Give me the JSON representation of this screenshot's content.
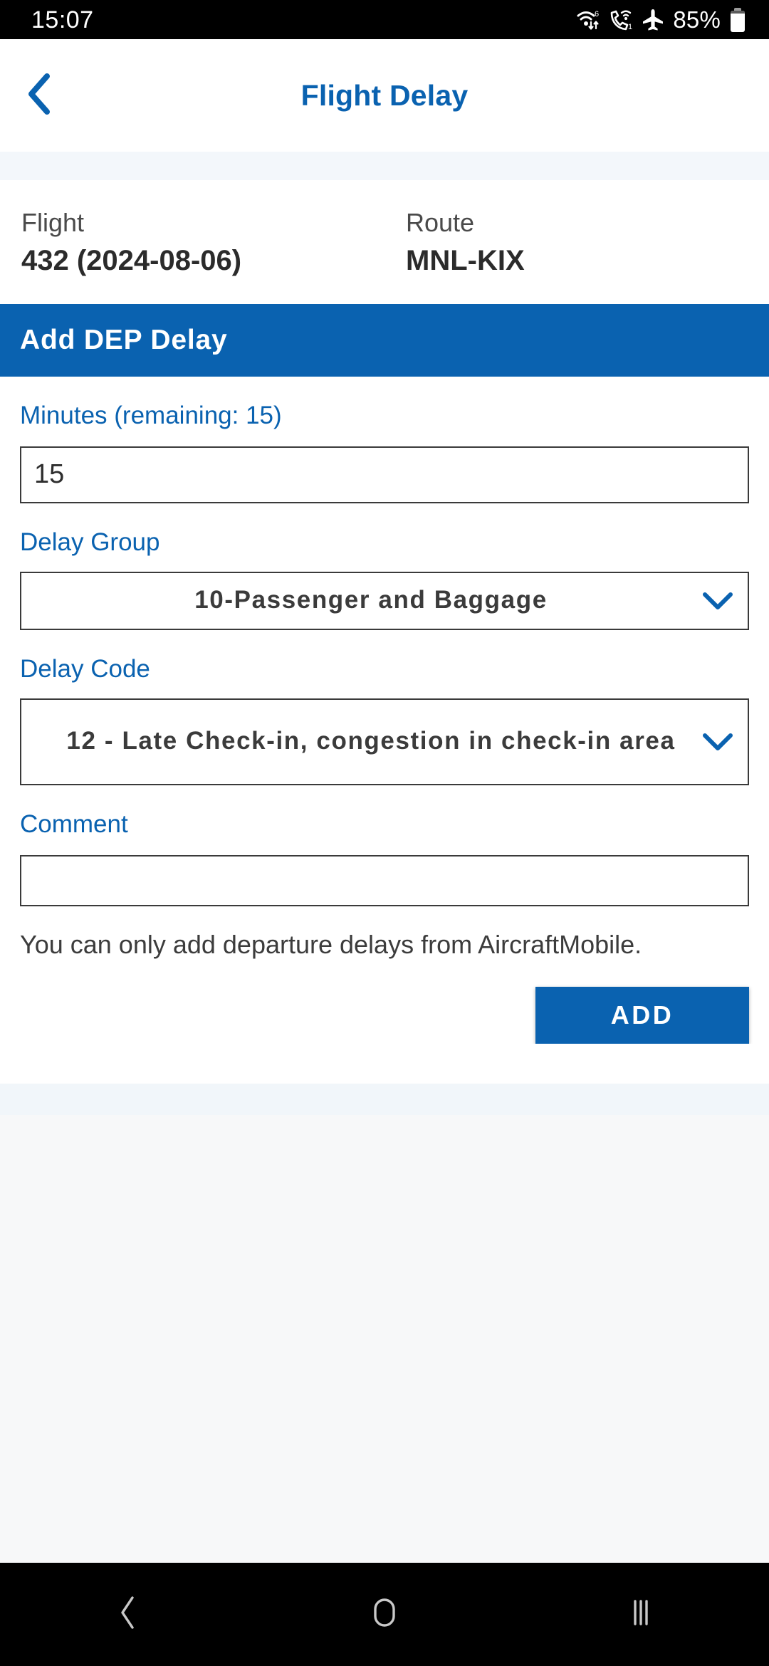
{
  "status_bar": {
    "time": "15:07",
    "battery_percent": "85%",
    "icons": [
      "wifi-6-icon",
      "wifi-calling-icon",
      "airplane-mode-icon",
      "battery-icon"
    ]
  },
  "header": {
    "title": "Flight Delay",
    "back_icon": "chevron-left-icon"
  },
  "flight_info": {
    "flight_label": "Flight",
    "flight_value": "432 (2024-08-06)",
    "route_label": "Route",
    "route_value": "MNL-KIX"
  },
  "section": {
    "title": "Add DEP Delay"
  },
  "form": {
    "minutes": {
      "label": "Minutes (remaining: 15)",
      "value": "15",
      "placeholder": ""
    },
    "delay_group": {
      "label": "Delay Group",
      "value": "10-Passenger and Baggage",
      "chevron_icon": "chevron-down-icon"
    },
    "delay_code": {
      "label": "Delay Code",
      "value": "12 - Late Check-in, congestion in check-in area",
      "chevron_icon": "chevron-down-icon"
    },
    "comment": {
      "label": "Comment",
      "value": "",
      "placeholder": ""
    },
    "note": "You can only add departure delays from AircraftMobile.",
    "add_button": "ADD"
  },
  "nav_bar": {
    "back": "back-icon",
    "home": "home-icon",
    "recents": "recents-icon"
  },
  "colors": {
    "accent_blue": "#0a62b0",
    "label_blue": "#0a62b0",
    "text_dark": "#2e2e2e",
    "strip_tint": "#f3f7fb"
  }
}
